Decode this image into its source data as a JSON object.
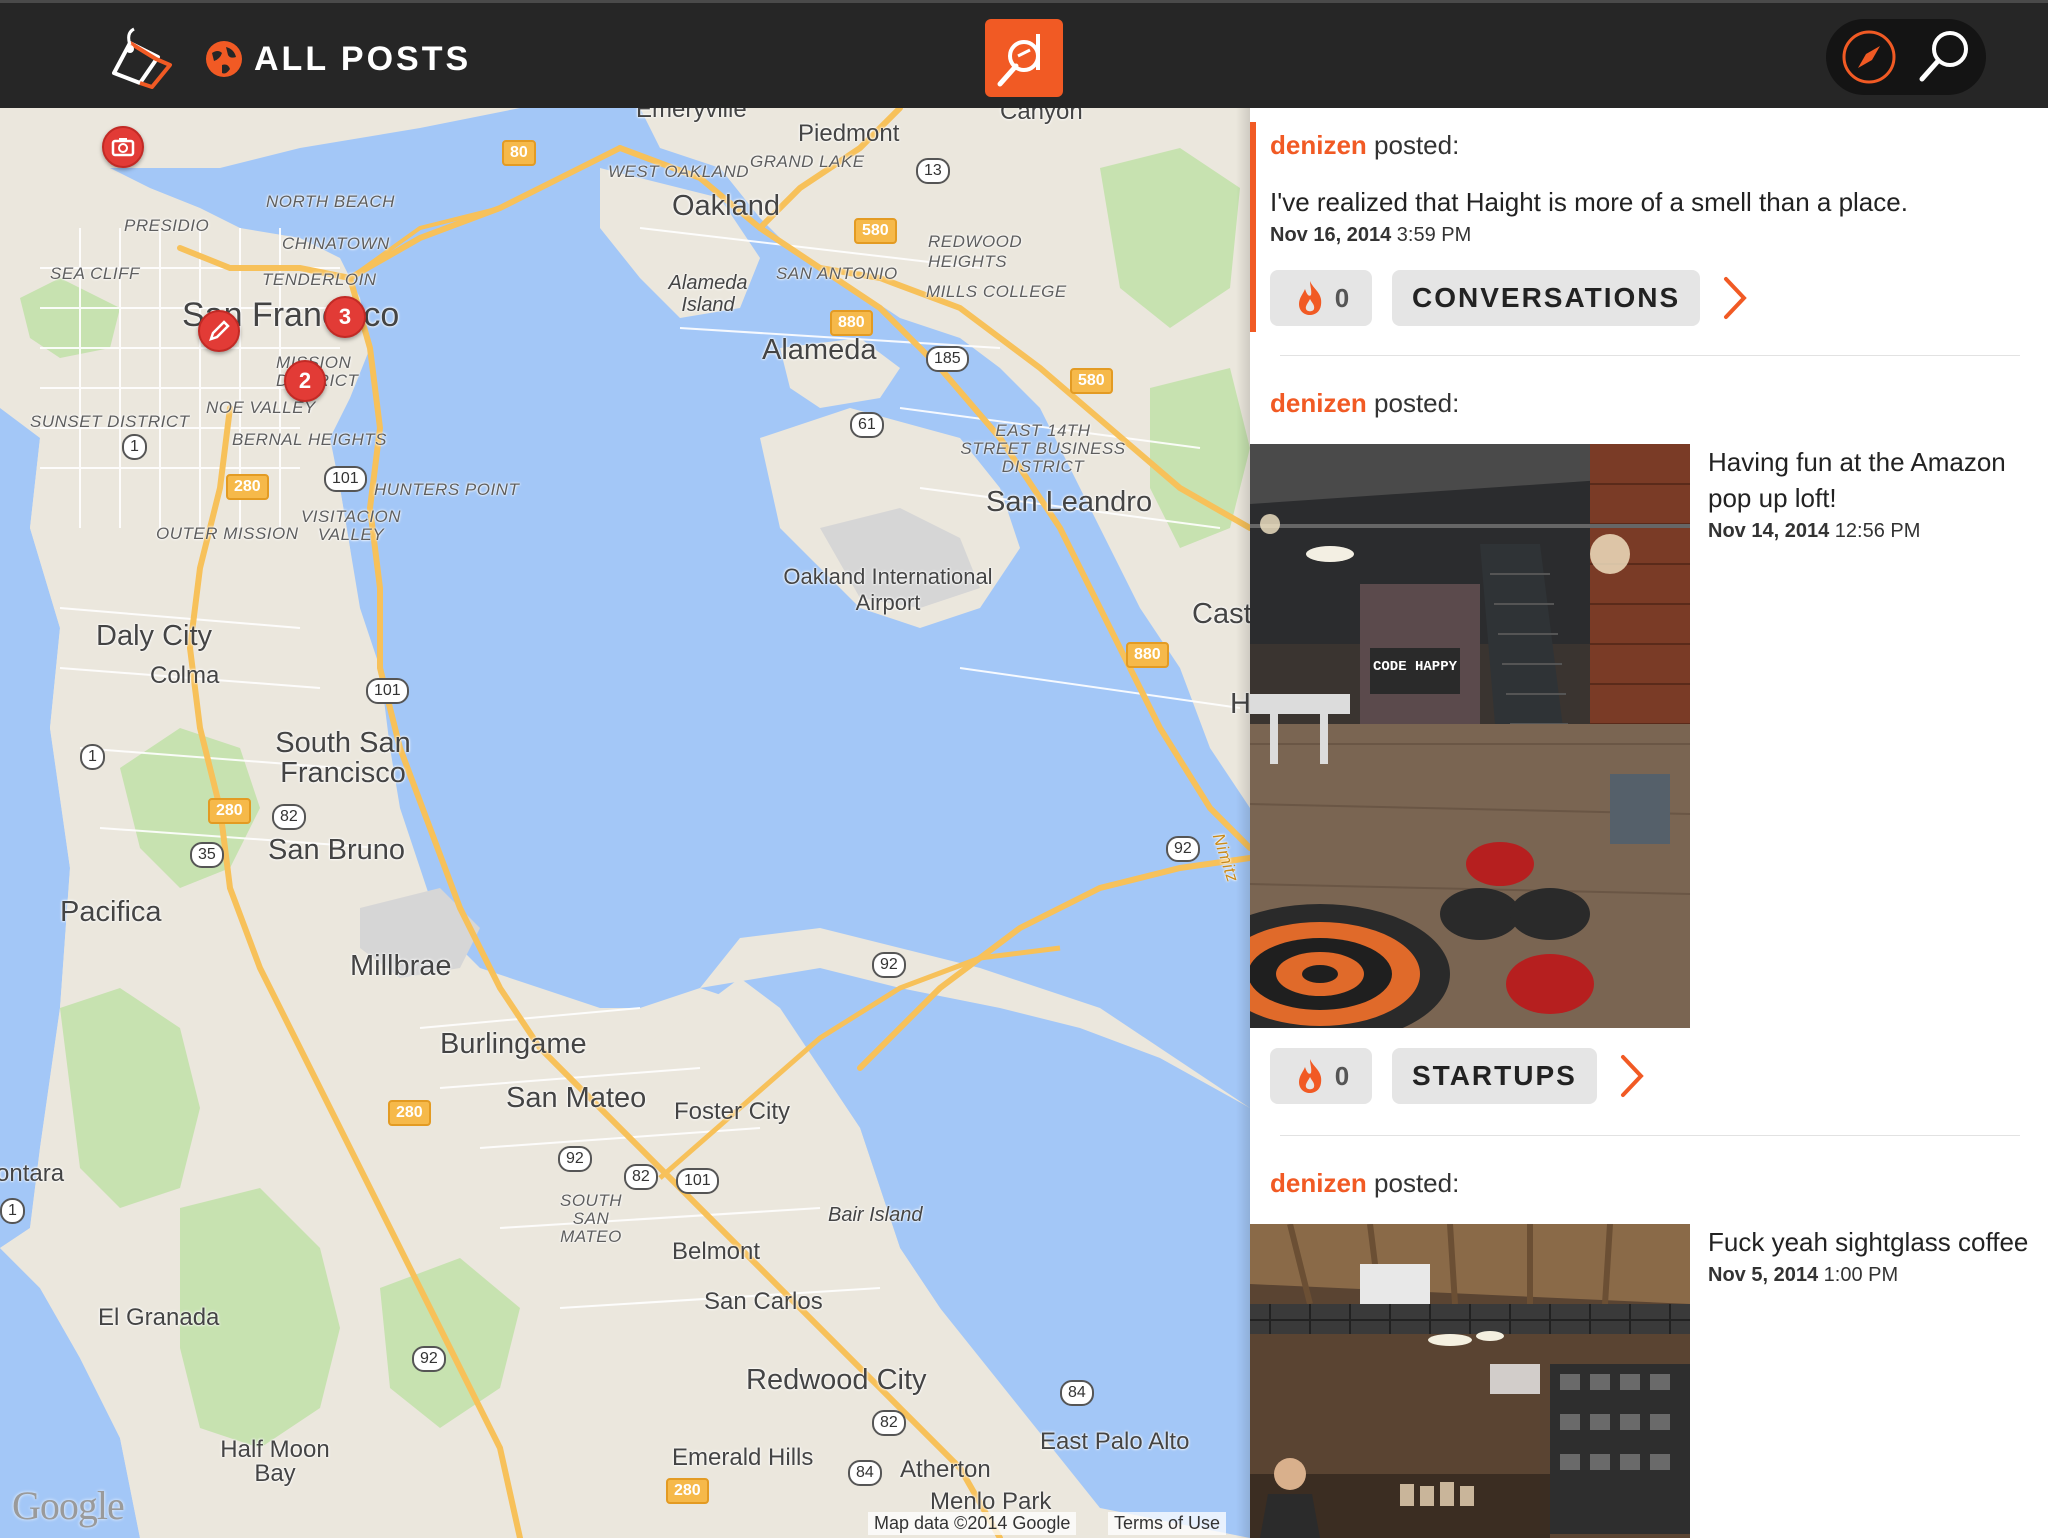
{
  "app": {
    "nav_title": "ALL POSTS",
    "icons": [
      "brand-tag-icon",
      "globe-icon",
      "logo-icon",
      "compass-icon",
      "search-icon"
    ],
    "accent_color": "#f15a24",
    "topbar_color": "#262626"
  },
  "map": {
    "attribution": "Map data ©2014 Google",
    "terms": "Terms of Use",
    "provider_logo": "Google",
    "places": {
      "emeryville": "Emeryville",
      "piedmont": "Piedmont",
      "canyon": "Canyon",
      "west_oakland": "WEST OAKLAND",
      "grand_lake": "GRAND LAKE",
      "oakland": "Oakland",
      "north_beach": "NORTH BEACH",
      "presidio": "PRESIDIO",
      "chinatown": "CHINATOWN",
      "sea_cliff": "SEA CLIFF",
      "tenderloin": "TENDERLOIN",
      "redwood_heights": "REDWOOD HEIGHTS",
      "san_antonio": "SAN ANTONIO",
      "mills_college": "MILLS COLLEGE",
      "alameda_island": "Alameda Island",
      "san_francisco": "San Francisco",
      "alameda": "Alameda",
      "mission_district": "MISSION DISTRICT",
      "noe_valley": "NOE VALLEY",
      "sunset_district": "SUNSET DISTRICT",
      "bernal_heights": "BERNAL HEIGHTS",
      "east_14th": "EAST 14TH STREET BUSINESS DISTRICT",
      "hunters_point": "HUNTERS POINT",
      "san_leandro": "San Leandro",
      "visitacion_valley": "VISITACION VALLEY",
      "outer_mission": "OUTER MISSION",
      "oakland_airport": "Oakland International Airport",
      "castro_valley": "Cast",
      "daly_city": "Daly City",
      "colma": "Colma",
      "south_sf": "South San Francisco",
      "san_bruno": "San Bruno",
      "pacifica": "Pacifica",
      "millbrae": "Millbrae",
      "burlingame": "Burlingame",
      "san_mateo": "San Mateo",
      "foster_city": "Foster City",
      "montara": "ontara",
      "south_san_mateo": "SOUTH SAN MATEO",
      "bair_island": "Bair Island",
      "belmont": "Belmont",
      "san_carlos": "San Carlos",
      "el_granada": "El Granada",
      "redwood_city": "Redwood City",
      "half_moon_bay": "Half Moon Bay",
      "emerald_hills": "Emerald Hills",
      "atherton": "Atherton",
      "east_palo_alto": "East Palo Alto",
      "menlo_park": "Menlo Park",
      "hayward_h": "H",
      "nimitz": "Nimitz"
    },
    "shields": {
      "i80": "80",
      "r13": "13",
      "i580a": "580",
      "i880a": "880",
      "r185": "185",
      "i580b": "580",
      "r61": "61",
      "r1a": "1",
      "i280a": "280",
      "us101a": "101",
      "us101b": "101",
      "r1b": "1",
      "i280b": "280",
      "r82a": "82",
      "r35": "35",
      "i880b": "880",
      "r92a": "92",
      "r92b": "92",
      "i280c": "280",
      "r92c": "92",
      "r82b": "82",
      "us101c": "101",
      "r1c": "1",
      "r92d": "92",
      "r84a": "84",
      "r82c": "82",
      "r84b": "84",
      "i280d": "280"
    },
    "clusters": [
      "3",
      "2"
    ]
  },
  "feed": {
    "posts": [
      {
        "author": "denizen",
        "verb": "posted:",
        "text": "I've realized that Haight is more of a smell than a place.",
        "date": "Nov 16, 2014",
        "time": "3:59 PM",
        "likes": "0",
        "tag": "CONVERSATIONS"
      },
      {
        "author": "denizen",
        "verb": "posted:",
        "text": "Having fun at the Amazon pop up loft!",
        "date": "Nov 14, 2014",
        "time": "12:56 PM",
        "likes": "0",
        "tag": "STARTUPS",
        "photo_sign": "CODE HAPPY"
      },
      {
        "author": "denizen",
        "verb": "posted:",
        "text": "Fuck yeah sightglass coffee",
        "date": "Nov 5, 2014",
        "time": "1:00 PM"
      }
    ]
  }
}
